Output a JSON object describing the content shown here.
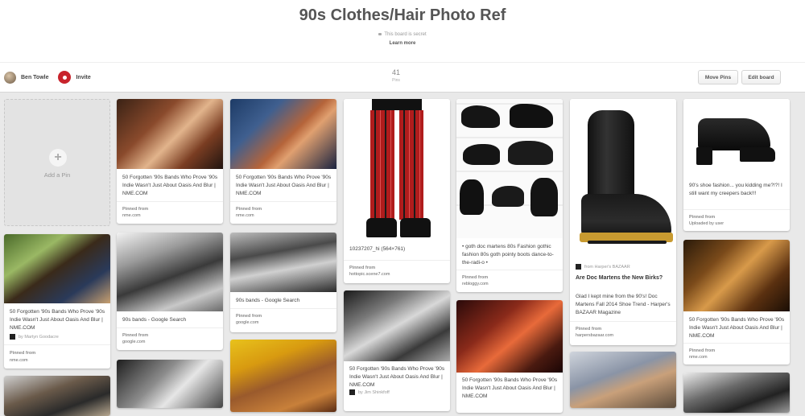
{
  "board": {
    "title": "90s Clothes/Hair Photo Ref",
    "secret_notice": "This board is secret",
    "learn_more": "Learn more",
    "owner": "Ben Towle",
    "invite": "Invite",
    "pin_count": "41",
    "pin_count_label": "Pins",
    "move_pins": "Move Pins",
    "edit_board": "Edit board"
  },
  "add_pin": {
    "label": "Add a Pin",
    "plus": "+"
  },
  "pins": [
    {
      "description": "50 Forgotten '90s Bands Who Prove '90s Indie Wasn't Just About Oasis And Blur | NME.COM",
      "pinned_from_label": "Pinned from",
      "source": "nme.com"
    },
    {
      "description": "50 Forgotten '90s Bands Who Prove '90s Indie Wasn't Just About Oasis And Blur | NME.COM",
      "pinned_from_label": "Pinned from",
      "source": "nme.com"
    },
    {
      "description": "10237207_hi (564×761)",
      "pinned_from_label": "Pinned from",
      "source": "hottopic.scene7.com"
    },
    {
      "description": "• goth doc martens 80s Fashion gothic fashion 80s goth pointy boots dance-to-the-radi-o •",
      "pinned_from_label": "Pinned from",
      "source": "rebloggy.com"
    },
    {
      "attribution": "from Harper's BAZAAR",
      "title": "Are Doc Martens the New Birks?",
      "description": "Glad I kept mine from the 90's! Doc Martens Fall 2014 Shoe Trend - Harper's BAZAAR Magazine",
      "pinned_from_label": "Pinned from",
      "source": "harpersbazaar.com"
    },
    {
      "description": "90's shoe fashion... you kidding me?!?! I still want my creepers back!!!",
      "pinned_from_label": "Pinned from",
      "source": "Uploaded by user"
    },
    {
      "description": "50 Forgotten '90s Bands Who Prove '90s Indie Wasn't Just About Oasis And Blur | NME.COM",
      "byline": "by Martyn Goodacre",
      "pinned_from_label": "Pinned from",
      "source": "nme.com"
    },
    {
      "description": "90s bands - Google Search",
      "pinned_from_label": "Pinned from",
      "source": "google.com"
    },
    {
      "description": "90s bands - Google Search",
      "pinned_from_label": "Pinned from",
      "source": "google.com"
    },
    {
      "description": "50 Forgotten '90s Bands Who Prove '90s Indie Wasn't Just About Oasis And Blur | NME.COM",
      "byline": "by Jim Shinkfoff"
    },
    {
      "description": "50 Forgotten '90s Bands Who Prove '90s Indie Wasn't Just About Oasis And Blur | NME.COM"
    },
    {
      "description": "50 Forgotten '90s Bands Who Prove '90s Indie Wasn't Just About Oasis And Blur | NME.COM",
      "pinned_from_label": "Pinned from",
      "source": "nme.com"
    }
  ]
}
